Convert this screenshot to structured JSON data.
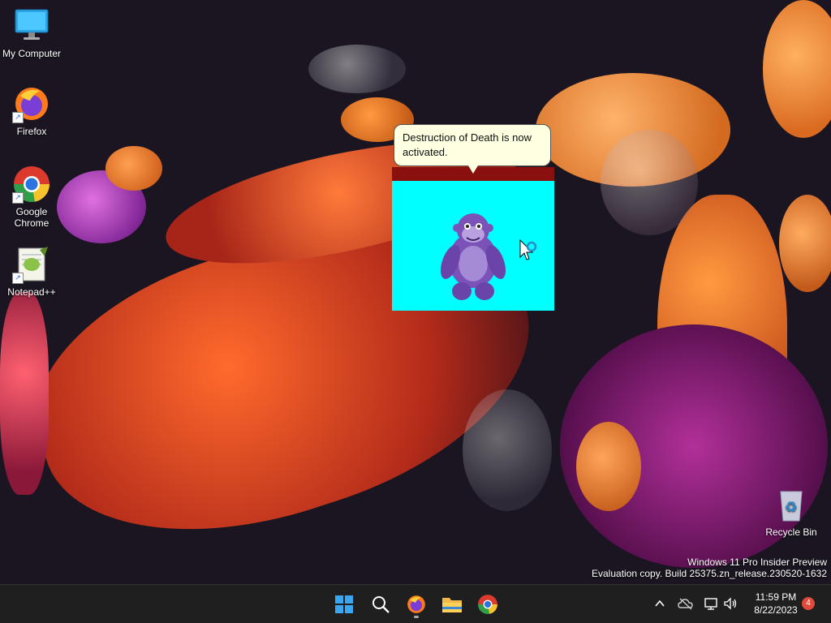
{
  "desktop_icons": [
    {
      "id": "my-computer",
      "label": "My Computer"
    },
    {
      "id": "firefox",
      "label": "Firefox"
    },
    {
      "id": "chrome",
      "label": "Google Chrome"
    },
    {
      "id": "notepadpp",
      "label": "Notepad++"
    },
    {
      "id": "recycle-bin",
      "label": "Recycle Bin"
    }
  ],
  "agent": {
    "balloon_text": "Destruction of Death is now activated.",
    "window_color": "#00ffff",
    "strip_color": "#8a1010",
    "character_icon": "purple-gorilla-icon"
  },
  "watermark": {
    "line1": "Windows 11 Pro Insider Preview",
    "line2": "Evaluation copy. Build 25375.zn_release.230520-1632"
  },
  "taskbar": {
    "pinned": [
      "start-icon",
      "search-icon",
      "firefox-icon",
      "file-explorer-icon",
      "chrome-icon"
    ],
    "tray": [
      "chevron-up-icon",
      "onedrive-offline-icon",
      "network-icon",
      "volume-icon"
    ],
    "time": "11:59 PM",
    "date": "8/22/2023",
    "notification_count": "4"
  },
  "colors": {
    "taskbar_bg": "#1f1f1f",
    "balloon_bg": "#ffffe1",
    "badge": "#e04a3a"
  }
}
